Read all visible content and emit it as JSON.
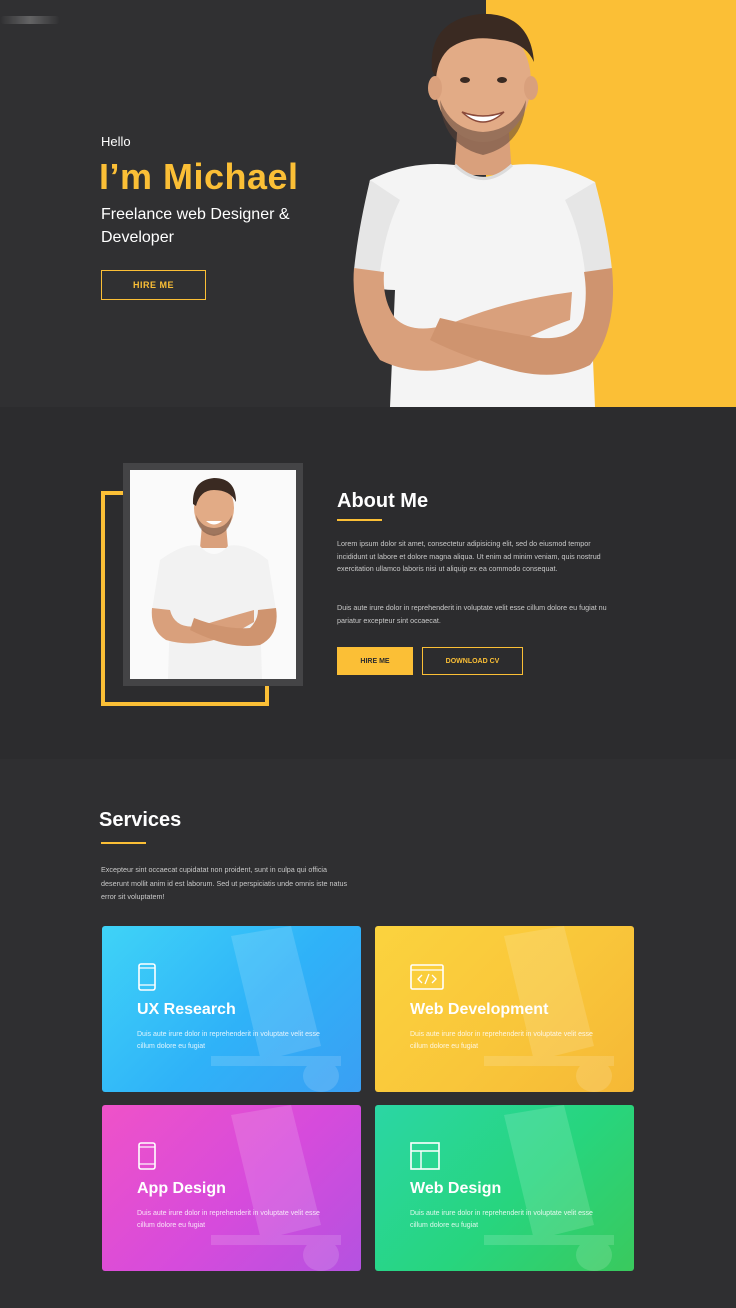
{
  "hero": {
    "greeting": "Hello",
    "name": "I’m Michael",
    "role": "Freelance web Designer & Developer",
    "hire_label": "HIRE ME"
  },
  "about": {
    "title": "About Me",
    "paragraph1": "Lorem ipsum dolor sit amet, consectetur adipisicing elit, sed do eiusmod tempor incididunt ut labore et dolore magna aliqua. Ut enim ad minim veniam, quis nostrud exercitation ullamco laboris nisi ut aliquip ex ea commodo consequat.",
    "paragraph2": "Duis aute irure dolor in reprehenderit in voluptate velit esse cillum dolore eu fugiat nu pariatur excepteur sint occaecat.",
    "hire_label": "HIRE ME",
    "download_label": "DOWNLOAD CV"
  },
  "services": {
    "title": "Services",
    "description": "Excepteur sint occaecat cupidatat non proident, sunt in culpa qui officia deserunt mollit anim id est laborum. Sed ut perspiciatis unde omnis iste natus error sit voluptatem!",
    "cards": [
      {
        "title": "UX Research",
        "text": "Duis aute irure dolor in reprehenderit in voluptate velit esse cillum dolore eu fugiat",
        "icon": "mobile-icon"
      },
      {
        "title": "Web Development",
        "text": "Duis aute irure dolor in reprehenderit in voluptate velit esse cillum dolore eu fugiat",
        "icon": "code-window-icon"
      },
      {
        "title": "App Design",
        "text": "Duis aute irure dolor in reprehenderit in voluptate velit esse cillum dolore eu fugiat",
        "icon": "mobile-icon"
      },
      {
        "title": "Web Design",
        "text": "Duis aute irure dolor in reprehenderit in voluptate velit esse cillum dolore eu fugiat",
        "icon": "layout-icon"
      }
    ]
  },
  "colors": {
    "accent": "#fbbf36",
    "background": "#2f2f31",
    "card_ux": "#2fb2f8",
    "card_webdev": "#f9c63a",
    "card_app": "#d64bdc",
    "card_webdesign": "#27d57e"
  }
}
